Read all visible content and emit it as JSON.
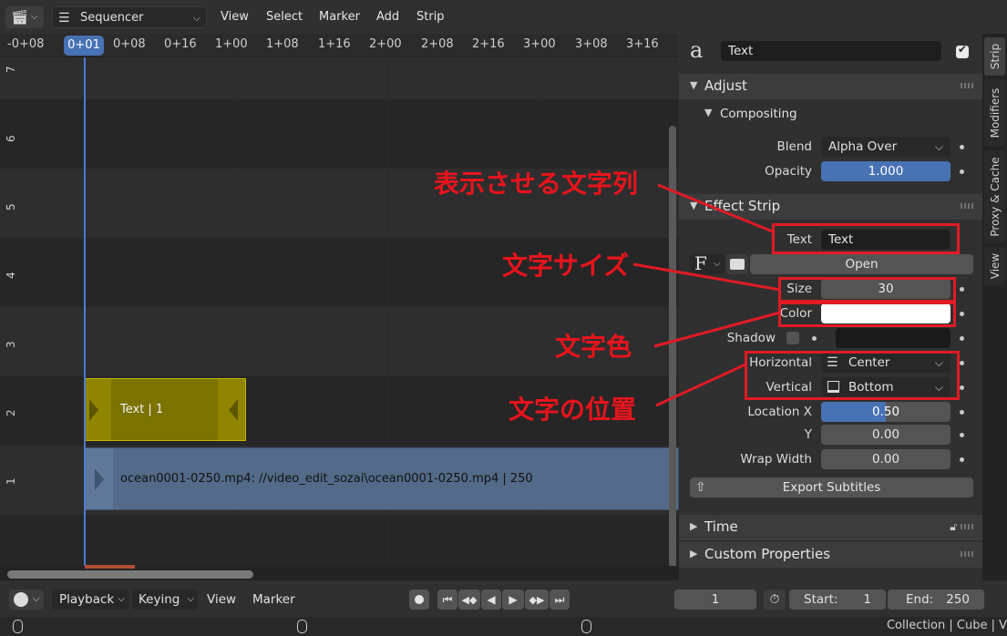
{
  "header": {
    "editor_icon": "sequencer-icon",
    "editor_name": "Sequencer",
    "menu": [
      "View",
      "Select",
      "Marker",
      "Add",
      "Strip"
    ]
  },
  "ruler": {
    "playhead": "0+01",
    "ticks": [
      "-0+08",
      "0+08",
      "0+16",
      "1+00",
      "1+08",
      "1+16",
      "2+00",
      "2+08",
      "2+16",
      "3+00",
      "3+08",
      "3+16"
    ]
  },
  "channels": [
    "7",
    "6",
    "5",
    "4",
    "3",
    "2",
    "1"
  ],
  "strips": {
    "text_strip": "Text | 1",
    "movie_strip": "ocean0001-0250.mp4: //video_edit_sozai\\ocean0001-0250.mp4 | 250"
  },
  "sidebar": {
    "strip_name": "Text",
    "tabs": [
      "Strip",
      "Modifiers",
      "Proxy & Cache",
      "View"
    ],
    "adjust": {
      "title": "Adjust",
      "compositing_title": "Compositing",
      "blend_label": "Blend",
      "blend_value": "Alpha Over",
      "opacity_label": "Opacity",
      "opacity_value": "1.000"
    },
    "effect_strip": {
      "title": "Effect Strip",
      "text_label": "Text",
      "text_value": "Text",
      "font_icon": "F",
      "open_label": "Open",
      "size_label": "Size",
      "size_value": "30",
      "color_label": "Color",
      "color_value": "#ffffff",
      "shadow_label": "Shadow",
      "horizontal_label": "Horizontal",
      "horizontal_value": "Center",
      "vertical_label": "Vertical",
      "vertical_value": "Bottom",
      "location_x_label": "Location X",
      "location_x_value": "0.50",
      "y_label": "Y",
      "y_value": "0.00",
      "wrap_width_label": "Wrap Width",
      "wrap_width_value": "0.00",
      "export_label": "Export Subtitles"
    },
    "time_title": "Time",
    "custom_properties_title": "Custom Properties"
  },
  "annotations": {
    "text_string": "表示させる文字列",
    "text_size": "文字サイズ",
    "text_color": "文字色",
    "text_position": "文字の位置"
  },
  "footer": {
    "playback": "Playback",
    "keying": "Keying",
    "view": "View",
    "marker": "Marker",
    "current_frame": "1",
    "start_label": "Start:",
    "start_value": "1",
    "end_label": "End:",
    "end_value": "250"
  },
  "status": "Collection | Cube | V"
}
